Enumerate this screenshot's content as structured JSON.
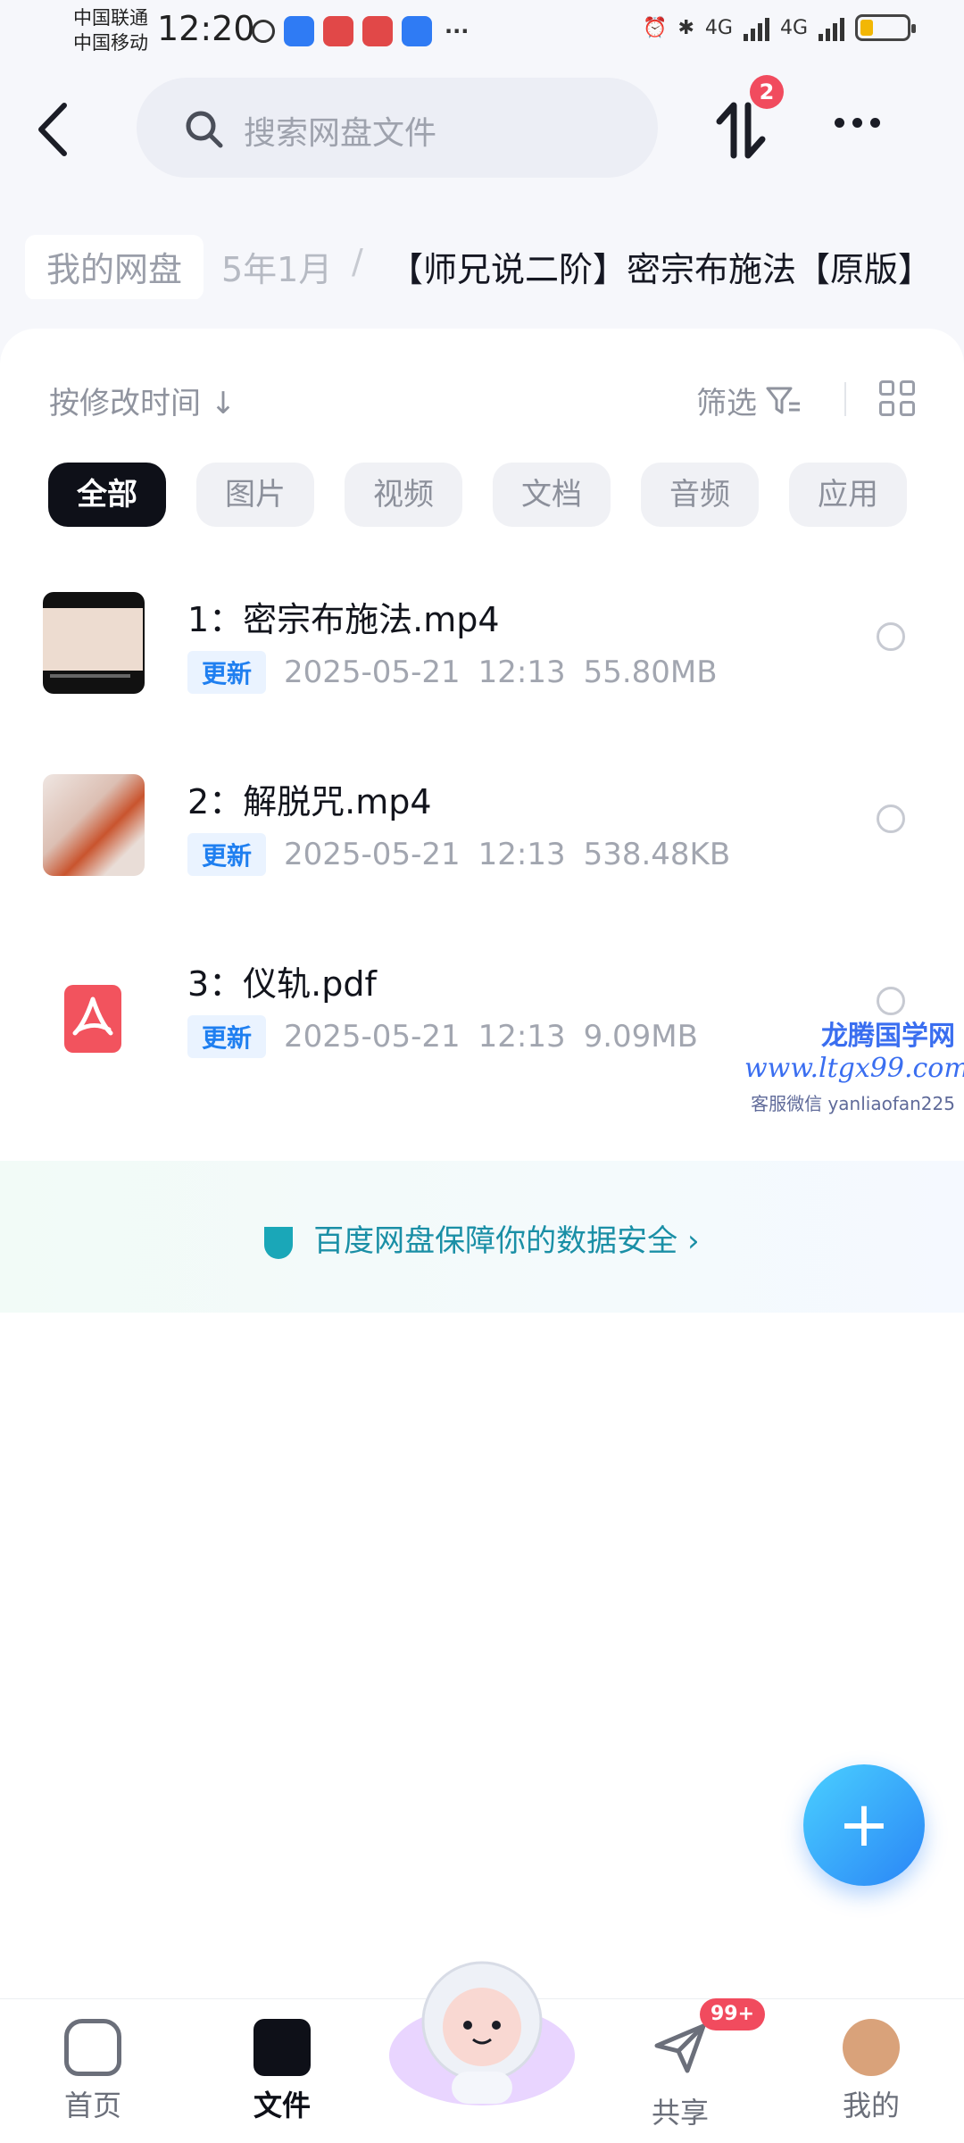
{
  "status_bar": {
    "carrier_1": "中国联通",
    "carrier_2": "中国移动",
    "time": "12:20",
    "net_1": "4G",
    "net_2": "4G"
  },
  "header": {
    "search_placeholder": "搜索网盘文件",
    "transfer_badge": "2"
  },
  "breadcrumb": {
    "root": "我的网盘",
    "middle": "5年1月",
    "separator": "/",
    "current": "【师兄说二阶】密宗布施法【原版】"
  },
  "toolbar": {
    "sort_label": "按修改时间",
    "sort_arrow": "↓",
    "filter_label": "筛选"
  },
  "chips": [
    "全部",
    "图片",
    "视频",
    "文档",
    "音频",
    "应用"
  ],
  "files": [
    {
      "name": "1：密宗布施法.mp4",
      "tag": "更新",
      "date": "2025-05-21",
      "time": "12:13",
      "size": "55.80MB"
    },
    {
      "name": "2：解脱咒.mp4",
      "tag": "更新",
      "date": "2025-05-21",
      "time": "12:13",
      "size": "538.48KB"
    },
    {
      "name": "3：仪轨.pdf",
      "tag": "更新",
      "date": "2025-05-21",
      "time": "12:13",
      "size": "9.09MB"
    }
  ],
  "watermark": {
    "line1": "龙腾国学网",
    "line2": "www.ltgx99.com",
    "line3": "客服微信 yanliaofan225"
  },
  "security_banner": {
    "text": "百度网盘保障你的数据安全",
    "chevron": "›"
  },
  "fab": {
    "symbol": "+"
  },
  "bottom_nav": {
    "home": "首页",
    "files": "文件",
    "share": "共享",
    "share_badge": "99+",
    "me": "我的"
  },
  "colors": {
    "accent": "#1f7ff0",
    "badge": "#f14b5e",
    "active_chip": "#0e1018",
    "security_text": "#1a8fa6"
  }
}
